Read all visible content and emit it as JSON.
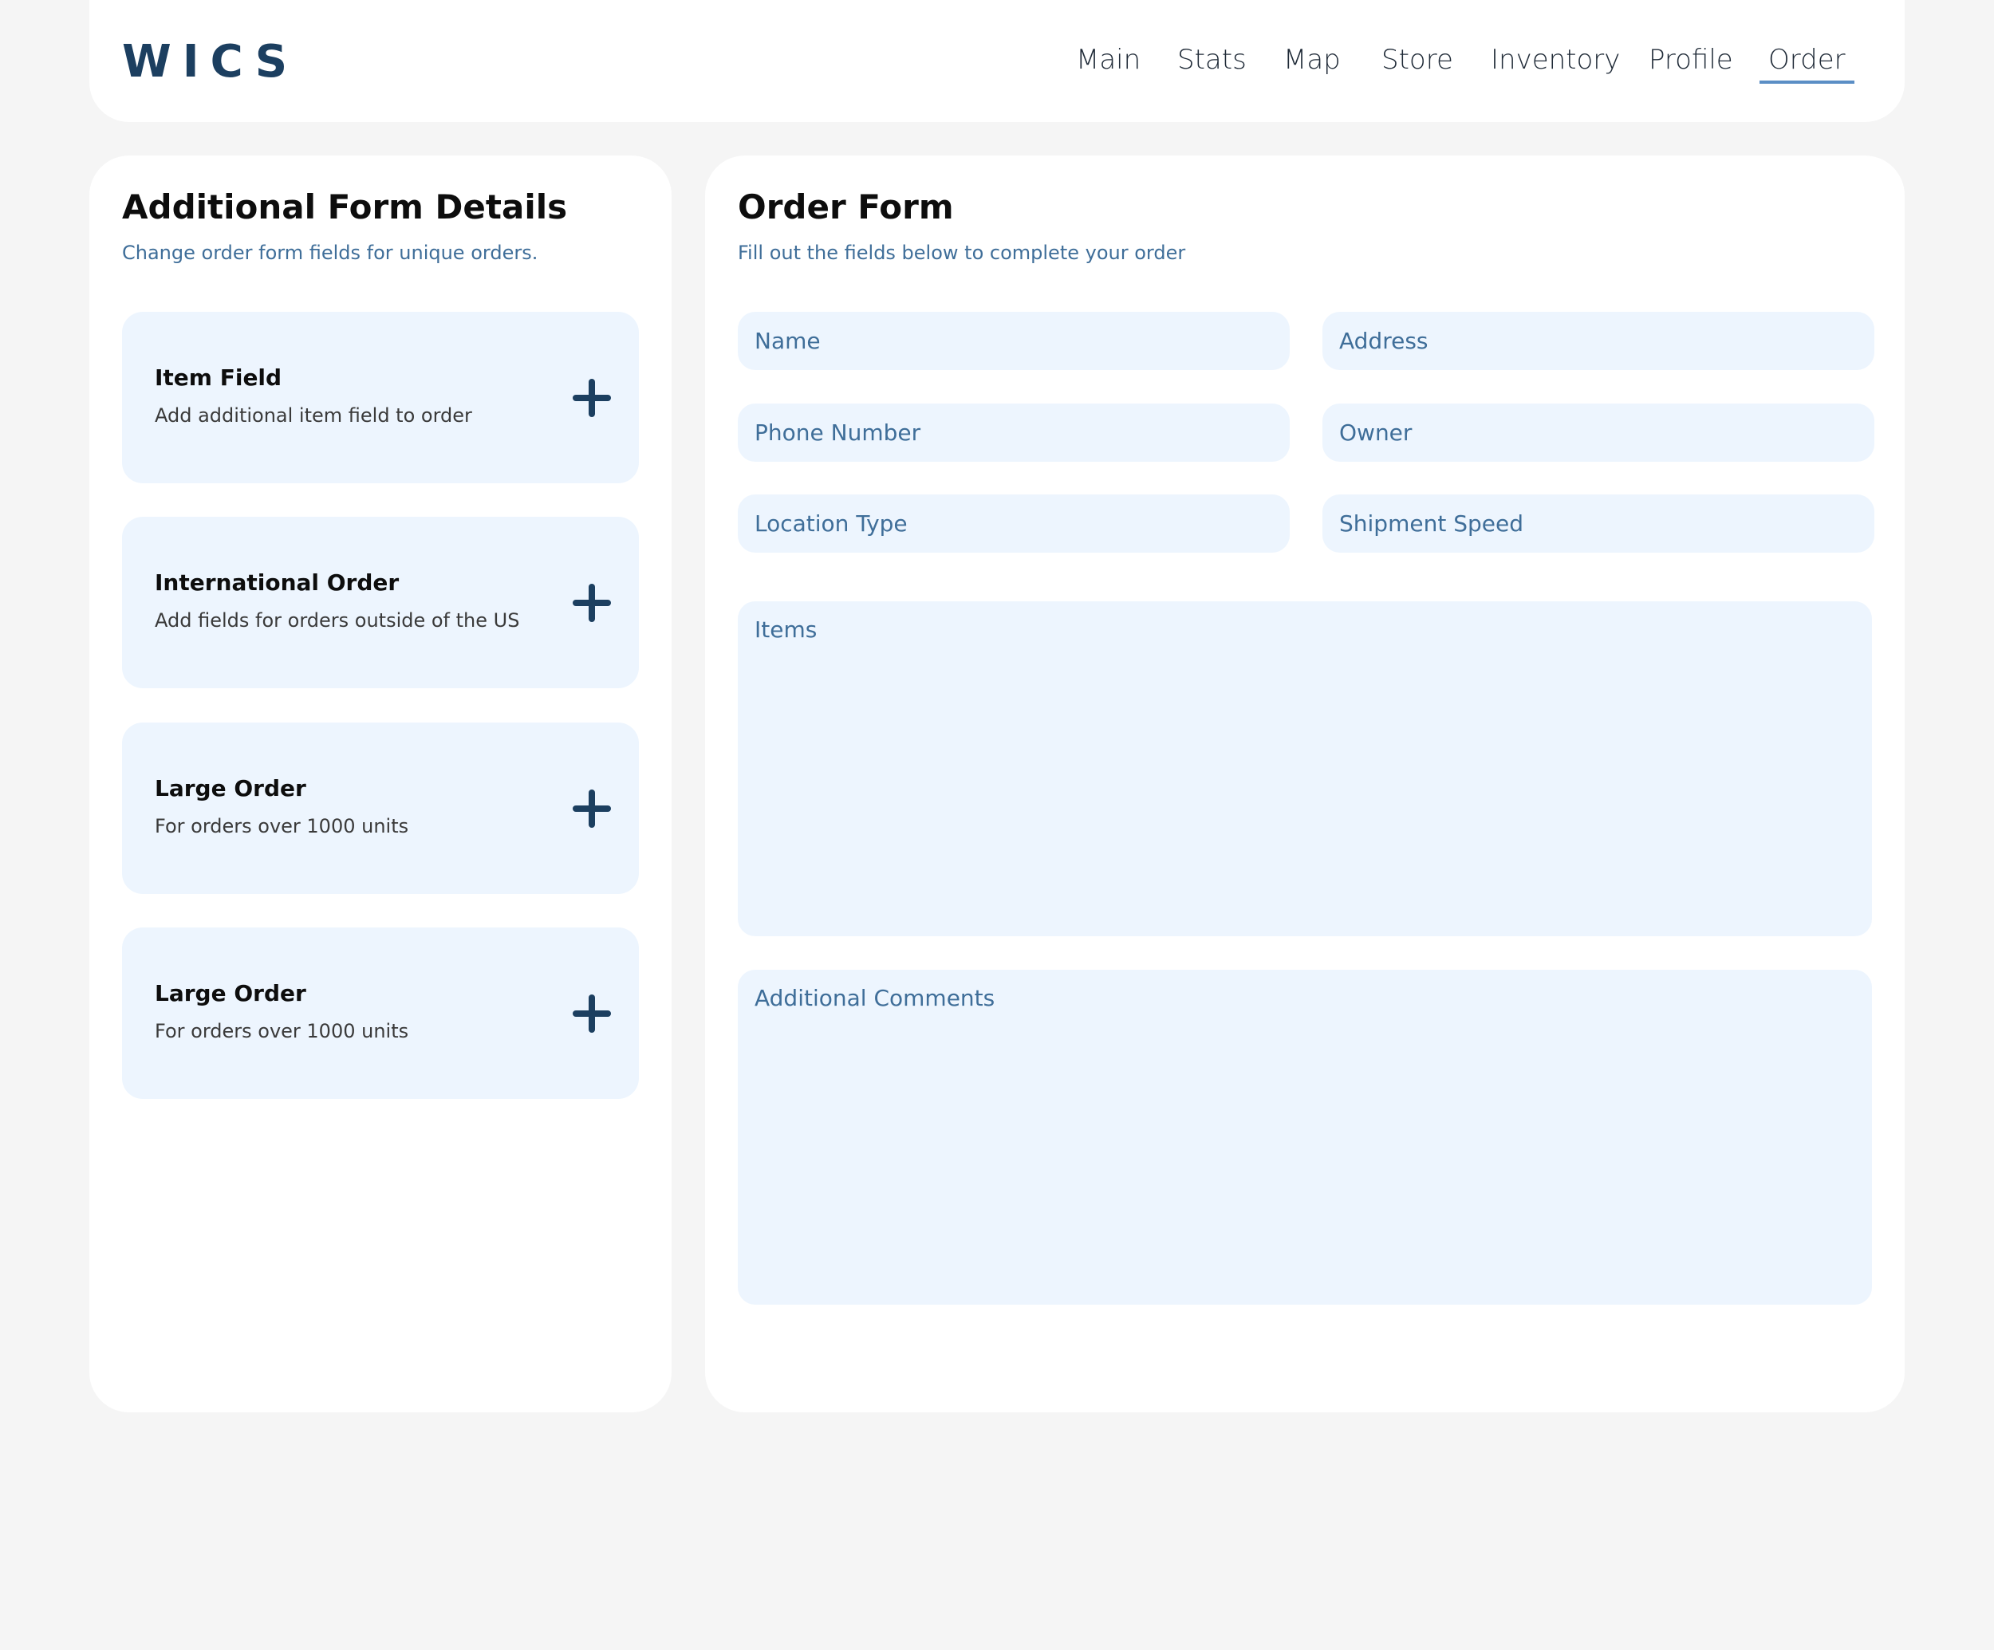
{
  "header": {
    "logo": "WICS",
    "nav": [
      {
        "label": "Main"
      },
      {
        "label": "Stats"
      },
      {
        "label": "Map"
      },
      {
        "label": "Store"
      },
      {
        "label": "Inventory"
      },
      {
        "label": "Profile"
      },
      {
        "label": "Order",
        "active": true
      }
    ]
  },
  "left_panel": {
    "title": "Additional Form Details",
    "subtitle": "Change order form fields for unique orders.",
    "cards": [
      {
        "title": "Item Field",
        "description": "Add additional item field to order",
        "icon": "plus-icon"
      },
      {
        "title": "International Order",
        "description": "Add fields for orders outside of the US",
        "icon": "plus-icon"
      },
      {
        "title": "Large Order",
        "description": "For orders over 1000 units",
        "icon": "plus-icon"
      },
      {
        "title": "Large Order",
        "description": "For orders over 1000 units",
        "icon": "plus-icon"
      }
    ]
  },
  "order_form": {
    "title": "Order Form",
    "subtitle": "Fill out the fields below to complete your order",
    "fields": {
      "name": {
        "placeholder": "Name",
        "value": ""
      },
      "address": {
        "placeholder": "Address",
        "value": ""
      },
      "phone": {
        "placeholder": "Phone Number",
        "value": ""
      },
      "owner": {
        "placeholder": "Owner",
        "value": ""
      },
      "location_type": {
        "placeholder": "Location Type",
        "value": ""
      },
      "shipment_speed": {
        "placeholder": "Shipment Speed",
        "value": ""
      },
      "items": {
        "placeholder": "Items",
        "value": ""
      },
      "comments": {
        "placeholder": "Additional Comments",
        "value": ""
      }
    }
  },
  "colors": {
    "brand": "#1c3f60",
    "accent": "#5b8ec5",
    "field_bg": "#edf5fe",
    "subtitle": "#3f6e99",
    "page_bg": "#f5f5f5"
  }
}
